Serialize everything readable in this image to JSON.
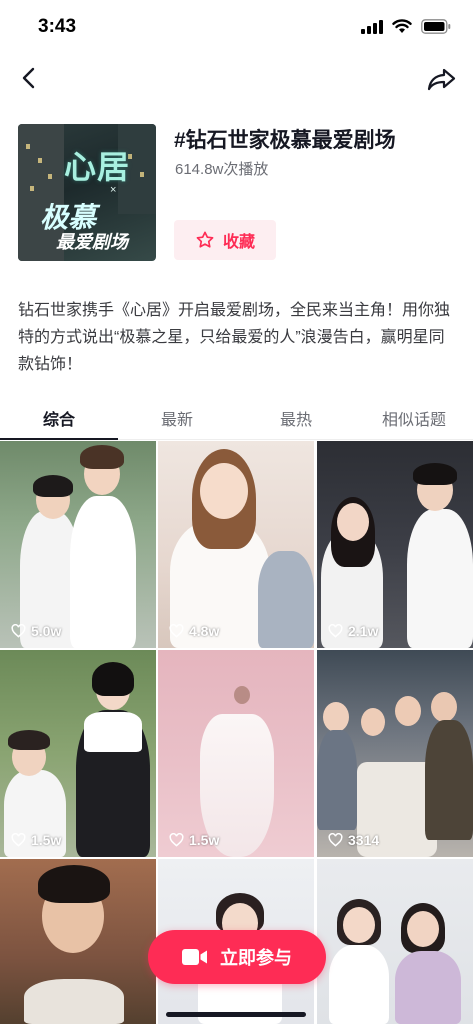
{
  "status_bar": {
    "time": "3:43"
  },
  "topic": {
    "title": "#钻石世家极慕最爱剧场",
    "plays": "614.8w次播放",
    "favorite_label": "收藏",
    "description": "钻石世家携手《心居》开启最爱剧场，全民来当主角！用你独特的方式说出“极慕之星，只给最爱的人”浪漫告白，赢明星同款钻饰！",
    "cover": {
      "line1": "心居",
      "line2": "×",
      "line3": "极慕",
      "line4": "最爱剧场"
    }
  },
  "tabs": [
    {
      "label": "综合",
      "active": true
    },
    {
      "label": "最新",
      "active": false
    },
    {
      "label": "最热",
      "active": false
    },
    {
      "label": "相似话题",
      "active": false
    }
  ],
  "videos": [
    {
      "likes": "5.0w"
    },
    {
      "likes": "4.8w"
    },
    {
      "likes": "2.1w"
    },
    {
      "likes": "1.5w"
    },
    {
      "likes": "1.5w"
    },
    {
      "likes": "3314"
    }
  ],
  "cta": {
    "label": "立即参与"
  },
  "colors": {
    "accent": "#fe2c55",
    "accent_light": "#fdeef1",
    "text_primary": "#161823",
    "text_secondary": "#6b6d74"
  },
  "icons": [
    "signal-icon",
    "wifi-icon",
    "battery-icon",
    "back-arrow-icon",
    "share-icon",
    "star-icon",
    "heart-icon",
    "video-camera-icon"
  ]
}
